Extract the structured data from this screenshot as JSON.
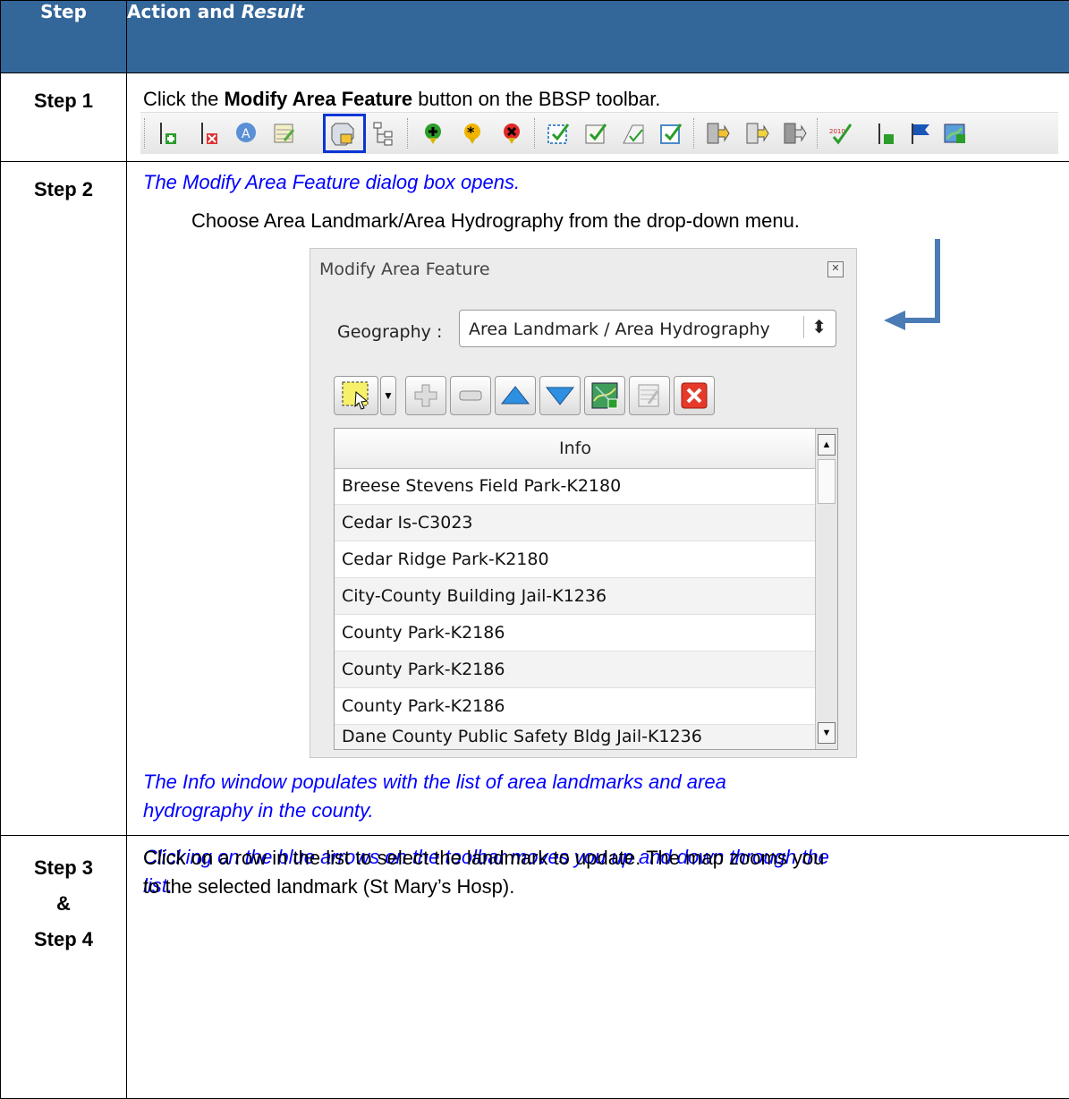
{
  "header": {
    "step": "Step",
    "action_prefix": "Action and ",
    "action_italic": "Result"
  },
  "step1": {
    "label": "Step 1",
    "text_before": "Click the ",
    "text_bold": "Modify Area Feature",
    "text_after": " button on the BBSP toolbar."
  },
  "step2": {
    "label": "Step 2",
    "result1": "The Modify Area Feature dialog box opens.",
    "instruction": "Choose Area Landmark/Area Hydrography from the drop-down menu.",
    "result2_line1": "The Info window populates with the list of area landmarks and area",
    "result2_line2": "hydrography in the county.",
    "result3_line1": "Clicking on the blue arrows on the toolbar moves you up and down through the",
    "result3_line2": "list."
  },
  "dialog": {
    "title": "Modify Area Feature",
    "geography_label": "Geography :",
    "geography_value": "Area Landmark / Area Hydrography",
    "grid_header": "Info",
    "rows": [
      "Breese Stevens Field Park-K2180",
      "Cedar Is-C3023",
      "Cedar Ridge Park-K2180",
      "City-County Building Jail-K1236",
      "County Park-K2186",
      "County Park-K2186",
      "County Park-K2186",
      "Dane County Public Safety Bldg Jail-K1236"
    ]
  },
  "step34": {
    "label_a": "Step 3",
    "label_amp": "&",
    "label_b": "Step 4",
    "line1": "Click on a row in the list to select the landmark to update. The map zooms you",
    "line2": "to the selected landmark (St Mary’s Hosp)."
  },
  "colors": {
    "header_bg": "#336699",
    "result_text": "#0000ff",
    "highlight": "#0b35d6",
    "arrow": "#4a7bb5"
  }
}
